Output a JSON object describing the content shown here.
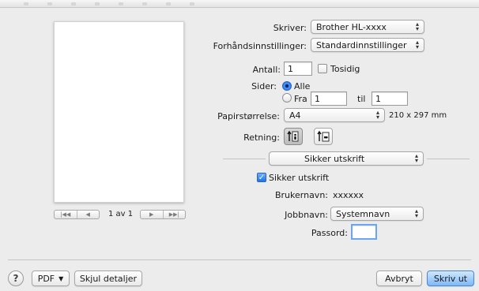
{
  "printer": {
    "label": "Skriver:",
    "value": "Brother HL-xxxx"
  },
  "presets": {
    "label": "Forhåndsinnstillinger:",
    "value": "Standardinnstillinger"
  },
  "copies": {
    "label": "Antall:",
    "value": "1",
    "two_sided_label": "Tosidig",
    "two_sided_checked": false
  },
  "pages": {
    "label": "Sider:",
    "all_label": "Alle",
    "from_label": "Fra",
    "from_value": "1",
    "to_label": "til",
    "to_value": "1",
    "selected": "Alle"
  },
  "paper_size": {
    "label": "Papirstørrelse:",
    "value": "A4",
    "dimensions": "210 x 297 mm"
  },
  "orientation": {
    "label": "Retning:",
    "selected": "portrait"
  },
  "section_menu": {
    "value": "Sikker utskrift"
  },
  "secure_print": {
    "checkbox_label": "Sikker utskrift",
    "checked": true,
    "username_label": "Brukernavn:",
    "username_value": "xxxxxx",
    "jobname_label": "Jobbnavn:",
    "jobname_value": "Systemnavn",
    "password_label": "Passord:",
    "password_value": ""
  },
  "preview_nav": {
    "page_text": "1 av 1"
  },
  "footer": {
    "help": "?",
    "pdf_label": "PDF",
    "hide_details_label": "Skjul detaljer",
    "cancel_label": "Avbryt",
    "print_label": "Skriv ut"
  },
  "colors": {
    "accent": "#1e74e6",
    "default_button": "#7eb8f6"
  }
}
